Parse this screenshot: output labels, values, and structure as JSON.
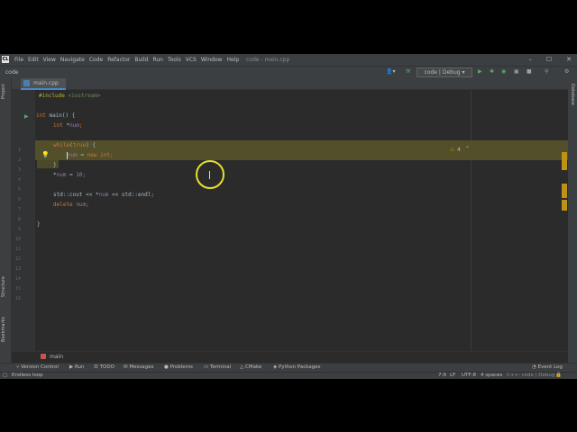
{
  "title_bar": {
    "menu": [
      "File",
      "Edit",
      "View",
      "Navigate",
      "Code",
      "Refactor",
      "Build",
      "Run",
      "Tools",
      "VCS",
      "Window",
      "Help"
    ],
    "window_title": "code - main.cpp"
  },
  "nav_bar": {
    "project": "code",
    "run_config": "code | Debug"
  },
  "editor": {
    "tab": "main.cpp",
    "warning_count": "4",
    "lines": [
      "1",
      "2",
      "3",
      "4",
      "5",
      "6",
      "7",
      "8",
      "9",
      "10",
      "11",
      "12",
      "13",
      "14",
      "15",
      "16"
    ],
    "code": {
      "l1_directive": "#include",
      "l1_header": "<iostream>",
      "l3_kw": "int",
      "l3_rest": " main() {",
      "l4_kw": "int",
      "l4_star": " *",
      "l4_var": "num",
      "l4_end": ";",
      "l6_kw": "while",
      "l6_paren": "(",
      "l6_true": "true",
      "l6_rest": ") {",
      "l7_var": "num",
      "l7_eq": " = ",
      "l7_new": "new",
      "l7_int": " int",
      "l7_end": ";",
      "l8_brace": "}",
      "l9_star": "*",
      "l9_var": "num",
      "l9_eq": " = ",
      "l9_num": "10",
      "l9_end": ";",
      "l11_a": "std::cout << *",
      "l11_var": "num",
      "l11_b": " << std::endl;",
      "l12_kw": "delete",
      "l12_sp": " ",
      "l12_var": "num",
      "l12_end": ";",
      "l14_brace": "}"
    },
    "breadcrumb": "main"
  },
  "left_strip": {
    "project": "Project",
    "structure": "Structure",
    "bookmarks": "Bookmarks"
  },
  "right_strip": {
    "database": "Database"
  },
  "tool_windows": [
    "Version Control",
    "Run",
    "TODO",
    "Messages",
    "Problems",
    "Terminal",
    "CMake",
    "Python Packages"
  ],
  "event_log": "Event Log",
  "status": {
    "message": "Endless loop",
    "position": "7:9",
    "line_sep": "LF",
    "encoding": "UTF-8",
    "indent": "4 spaces",
    "context": "C++: code | Debug"
  },
  "colors": {
    "editor_bg": "#2b2b2b",
    "highlight": "#524f2a",
    "keyword": "#cc7832",
    "warning": "#be9117",
    "cursor_ring": "#e8df2e"
  }
}
